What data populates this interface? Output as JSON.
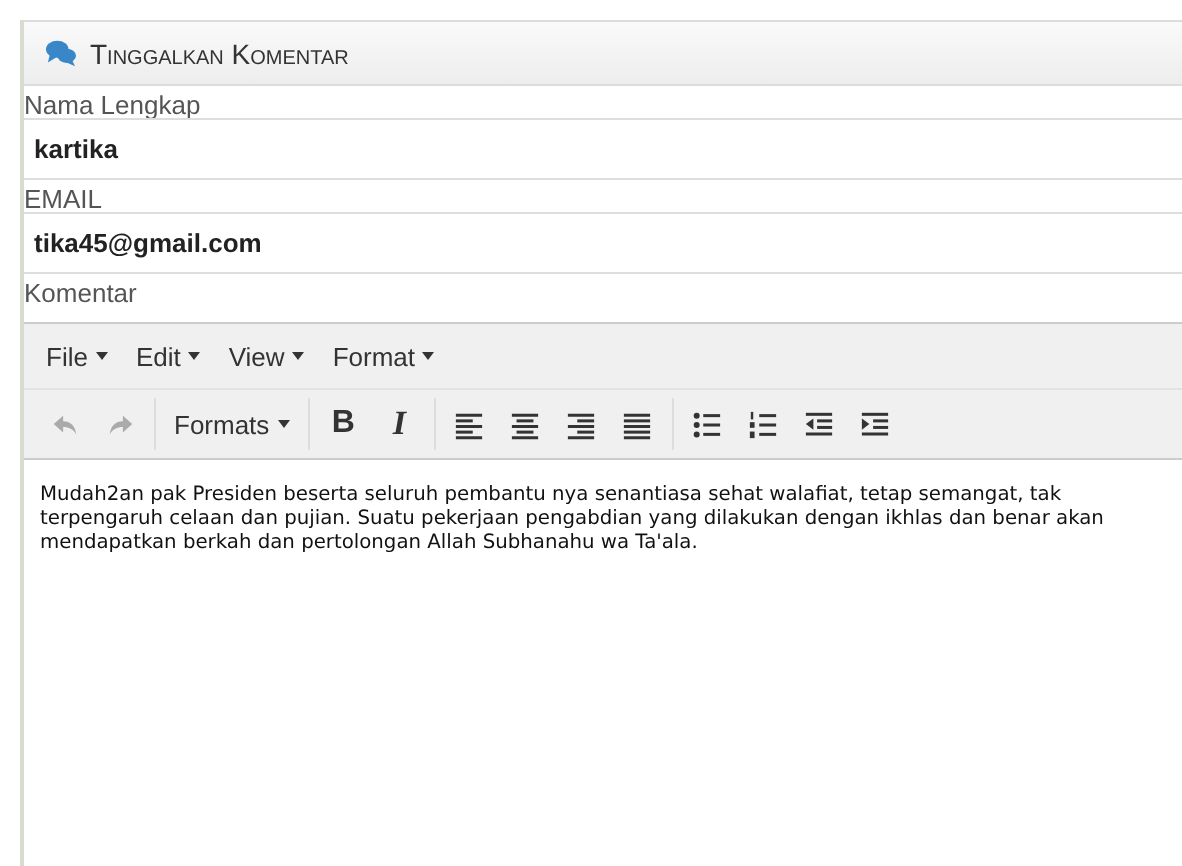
{
  "panel": {
    "title": "Tinggalkan Komentar"
  },
  "fields": [
    {
      "label": "Nama Lengkap",
      "value": "kartika"
    },
    {
      "label": "EMAIL",
      "value": "tika45@gmail.com"
    }
  ],
  "comment_label": "Komentar",
  "editor": {
    "menus": [
      "File",
      "Edit",
      "View",
      "Format"
    ],
    "toolbar": [
      {
        "kind": "undo",
        "disabled": true
      },
      {
        "kind": "redo",
        "disabled": true
      },
      {
        "kind": "sep"
      },
      {
        "kind": "dropdown",
        "label": "Formats"
      },
      {
        "kind": "sep"
      },
      {
        "kind": "bold",
        "label": "B"
      },
      {
        "kind": "italic",
        "label": "I"
      },
      {
        "kind": "sep"
      },
      {
        "kind": "align-left"
      },
      {
        "kind": "align-center"
      },
      {
        "kind": "align-right"
      },
      {
        "kind": "align-justify"
      },
      {
        "kind": "sep"
      },
      {
        "kind": "bullet-list"
      },
      {
        "kind": "numbered-list"
      },
      {
        "kind": "outdent"
      },
      {
        "kind": "indent"
      }
    ],
    "content": "Mudah2an pak Presiden beserta seluruh pembantu nya senantiasa sehat walafiat, tetap semangat, tak terpengaruh celaan dan pujian. Suatu pekerjaan pengabdian yang dilakukan dengan ikhlas dan benar akan mendapatkan berkah dan pertolongan Allah Subhanahu wa Ta'ala."
  }
}
